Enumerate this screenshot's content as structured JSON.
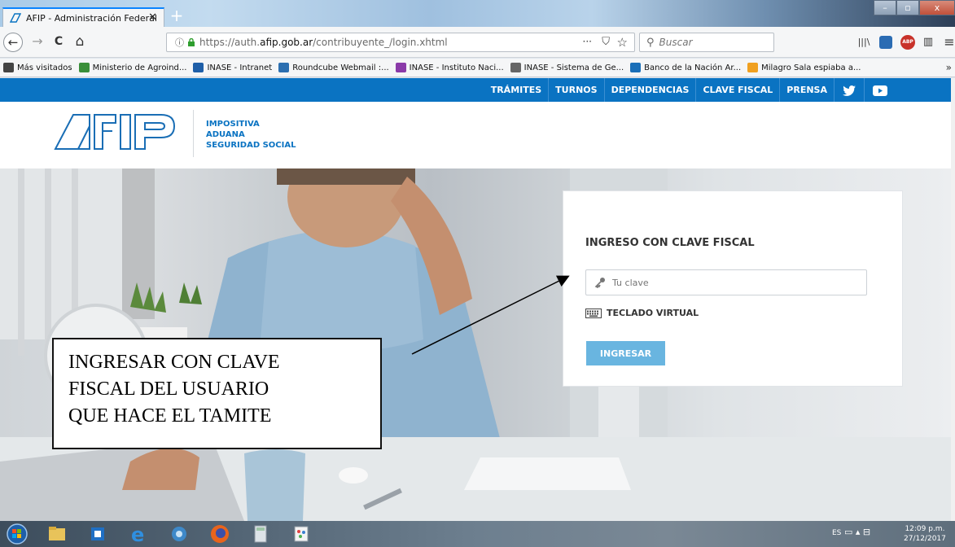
{
  "browser": {
    "tab_title": "AFIP - Administración Federal",
    "tab_close": "✕",
    "new_tab": "+",
    "nav": {
      "back": "←",
      "forward": "→",
      "reload": "C",
      "home": "⌂"
    },
    "url_info": "ⓘ",
    "url_prefix": "https://auth.",
    "url_domain": "afip.gob.ar",
    "url_path": "/contribuyente_/login.xhtml",
    "url_actions": {
      "more": "···",
      "pocket": "⛉",
      "bookmark": "☆"
    },
    "search_placeholder": "Buscar",
    "toolbar_icons": {
      "library": "|||\\",
      "abp": "ABP",
      "sidebar": "▥",
      "menu": "≡"
    },
    "window_controls": {
      "minimize": "–",
      "maximize": "▫",
      "close": "x"
    }
  },
  "bookmarks": [
    {
      "label": "Más visitados",
      "icon": "gear-icon",
      "color": "#444444"
    },
    {
      "label": "Ministerio de Agroind...",
      "icon": "leaf-icon",
      "color": "#3a8f3a"
    },
    {
      "label": "INASE - Intranet",
      "icon": "inase-icon",
      "color": "#1f5fa8"
    },
    {
      "label": "Roundcube Webmail :...",
      "icon": "mail-icon",
      "color": "#2c6fb0"
    },
    {
      "label": "INASE - Instituto Naci...",
      "icon": "inase-logo-icon",
      "color": "#8a3aa8"
    },
    {
      "label": "INASE - Sistema de Ge...",
      "icon": "globe-icon",
      "color": "#666666"
    },
    {
      "label": "Banco de la Nación Ar...",
      "icon": "bank-icon",
      "color": "#1a6fb8"
    },
    {
      "label": "Milagro Sala espiaba a...",
      "icon": "news-icon",
      "color": "#f0a020"
    }
  ],
  "bookmarks_more": "»",
  "afip": {
    "top_links": [
      "TRÁMITES",
      "TURNOS",
      "DEPENDENCIAS",
      "CLAVE FISCAL",
      "PRENSA"
    ],
    "social_icons": [
      "twitter-icon",
      "youtube-icon"
    ],
    "tagline": [
      "IMPOSITIVA",
      "ADUANA",
      "SEGURIDAD SOCIAL"
    ],
    "brand_color": "#0a73c2"
  },
  "login": {
    "title": "INGRESO CON CLAVE FISCAL",
    "password_placeholder": "Tu clave",
    "virtual_keyboard": "TECLADO VIRTUAL",
    "submit": "INGRESAR",
    "button_color": "#69b5e0"
  },
  "annotation": {
    "lines": [
      "INGRESAR CON CLAVE",
      "FISCAL DEL USUARIO",
      "QUE HACE EL TAMITE"
    ]
  },
  "taskbar": {
    "apps": [
      "start-orb-icon",
      "file-explorer-icon",
      "outlook-icon",
      "internet-explorer-icon",
      "network-icon",
      "firefox-icon",
      "calculator-icon",
      "paint-icon"
    ],
    "language": "ES",
    "time": "12:09 p.m.",
    "date": "27/12/2017"
  }
}
